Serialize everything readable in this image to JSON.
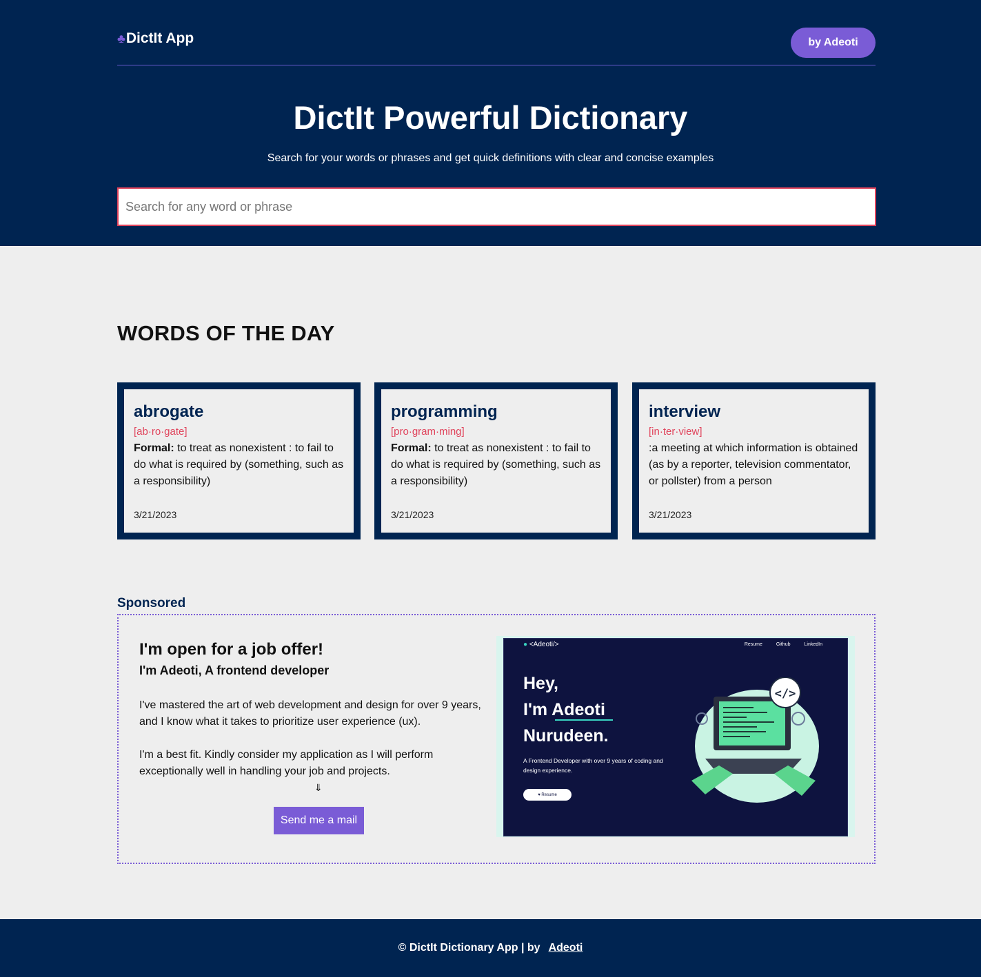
{
  "header": {
    "logo_icon": "club-icon",
    "logo_icon_glyph": "♣",
    "app_name": "DictIt App",
    "author_button": "by Adeoti"
  },
  "hero": {
    "title": "DictIt Powerful Dictionary",
    "subtitle": "Search for your words or phrases and get quick definitions with clear and concise examples",
    "search_placeholder": "Search for any word or phrase"
  },
  "words_of_the_day": {
    "title": "WORDS OF THE DAY",
    "cards": [
      {
        "word": "abrogate",
        "pronunciation": "[ab·ro·gate]",
        "label": "Formal:",
        "definition": " to treat as nonexistent : to fail to do what is required by (something, such as a responsibility)",
        "date": "3/21/2023"
      },
      {
        "word": "programming",
        "pronunciation": "[pro·gram·ming]",
        "label": "Formal:",
        "definition": " to treat as nonexistent : to fail to do what is required by (something, such as a responsibility)",
        "date": "3/21/2023"
      },
      {
        "word": "interview",
        "pronunciation": "[in·ter·view]",
        "label": "",
        "definition": ":a meeting at which information is obtained (as by a reporter, television commentator, or pollster) from a person",
        "date": "3/21/2023"
      }
    ]
  },
  "sponsored": {
    "label": "Sponsored",
    "heading": "I'm open for a job offer!",
    "subheading": "I'm Adeoti, A frontend developer",
    "paragraph1": "I've mastered the art of web development and design for over 9 years, and I know what it takes to prioritize user experience (ux).",
    "paragraph2": "I'm a best fit. Kindly consider my application as I will perform exceptionally well in handling your job and projects.",
    "arrow": "⇓",
    "button": "Send me a mail",
    "preview": {
      "logo": "<Adeoti/>",
      "links": [
        "Resume",
        "Github",
        "LinkedIn"
      ],
      "line1": "Hey,",
      "line2": "I'm Adeoti",
      "line3": "Nurudeen.",
      "description": "A Frontend Developer with over 9 years of coding and design experience.",
      "resume_button": "♥ Resume"
    }
  },
  "footer": {
    "text": "© DictIt Dictionary App |  by",
    "link": "Adeoti"
  },
  "colors": {
    "navy": "#002451",
    "purple": "#7a5cd6",
    "accent_red": "#e0435b",
    "background": "#eeeeee"
  }
}
